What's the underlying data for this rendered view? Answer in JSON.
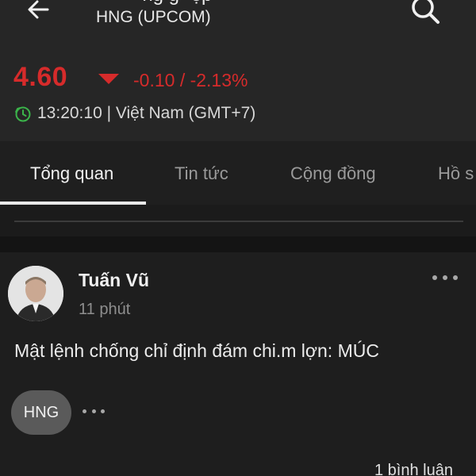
{
  "header": {
    "back_icon": "arrow-left-icon",
    "title_partial": "· · ng g ·ệp ·",
    "exchange": "HNG (UPCOM)",
    "search_icon": "search-icon"
  },
  "quote": {
    "price": "4.60",
    "direction_icon": "triangle-down-icon",
    "change": "-0.10 / -2.13%",
    "time_icon": "clock-icon",
    "time": "13:20:10 | Việt Nam (GMT+7)",
    "colors": {
      "down": "#d62b2b",
      "time_icon": "#3bb34a"
    }
  },
  "tabs": [
    {
      "label": "Tổng quan",
      "active": true
    },
    {
      "label": "Tin tức",
      "active": false
    },
    {
      "label": "Cộng đồng",
      "active": false
    },
    {
      "label": "Hồ s",
      "active": false
    }
  ],
  "post": {
    "author": "Tuấn Vũ",
    "time": "11 phút",
    "more_icon": "more-horizontal-icon",
    "content": "Mật lệnh chống chỉ định đám chi.m lợn: MÚC",
    "tag": "HNG",
    "comments": "1 bình luận"
  }
}
